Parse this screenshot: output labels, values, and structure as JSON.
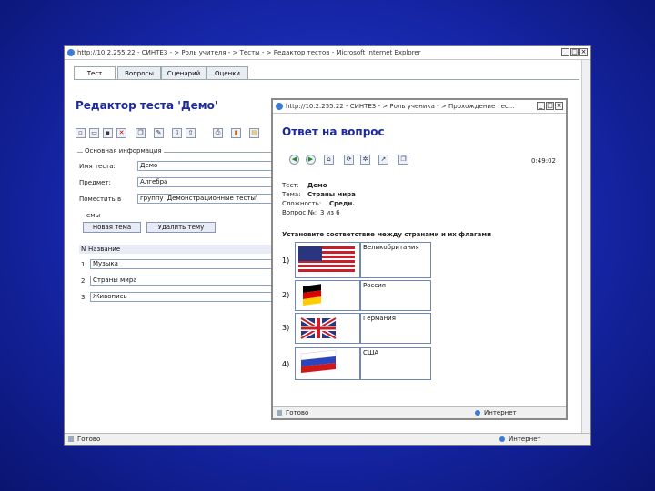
{
  "main_window": {
    "title": "http://10.2.255.22 - СИНТЕЗ - > Роль учителя - > Тесты - > Редактор тестов - Microsoft Internet Explorer",
    "tabs": [
      {
        "label": "Тест"
      },
      {
        "label": "Вопросы"
      },
      {
        "label": "Сценарий"
      },
      {
        "label": "Оценки"
      }
    ],
    "heading": "Редактор теста 'Демо'",
    "section_title": "Основная информация",
    "fields": {
      "name_label": "Имя теста:",
      "name_value": "Демо",
      "subject_label": "Предмет:",
      "subject_value": "Алгебра",
      "place_label": "Поместить в",
      "place_value": "группу 'Демонстрационные тесты'"
    },
    "themes_label": "емы",
    "new_theme_button": "Новая тема",
    "delete_theme_button": "Удалить тему",
    "grid": {
      "col_num": "N",
      "col_name": "Название",
      "rows": [
        {
          "num": "1",
          "name": "Музыка"
        },
        {
          "num": "2",
          "name": "Страны мира"
        },
        {
          "num": "3",
          "name": "Живопись"
        }
      ]
    },
    "status": {
      "left": "Готово",
      "right": "Интернет"
    }
  },
  "popup_window": {
    "title": "http://10.2.255.22 - СИНТЕЗ - > Роль ученика - > Прохождение тес...",
    "heading": "Ответ на вопрос",
    "timer": "0:49:02",
    "info": {
      "test_label": "Тест:",
      "test_value": "Демо",
      "theme_label": "Тема:",
      "theme_value": "Страны мира",
      "difficulty_label": "Сложность:",
      "difficulty_value": "Средн.",
      "question_label": "Вопрос №:",
      "question_value": "3 из 6"
    },
    "question": "Установите соответствие между странами и их флагами",
    "items": [
      {
        "num": "1)",
        "flag": "usa-flag",
        "country": "Великобритания"
      },
      {
        "num": "2)",
        "flag": "germany-flag",
        "country": "Россия"
      },
      {
        "num": "3)",
        "flag": "uk-flag",
        "country": "Германия"
      },
      {
        "num": "4)",
        "flag": "russia-flag",
        "country": "США"
      }
    ],
    "status": {
      "left": "Готово",
      "right": "Интернет"
    }
  }
}
